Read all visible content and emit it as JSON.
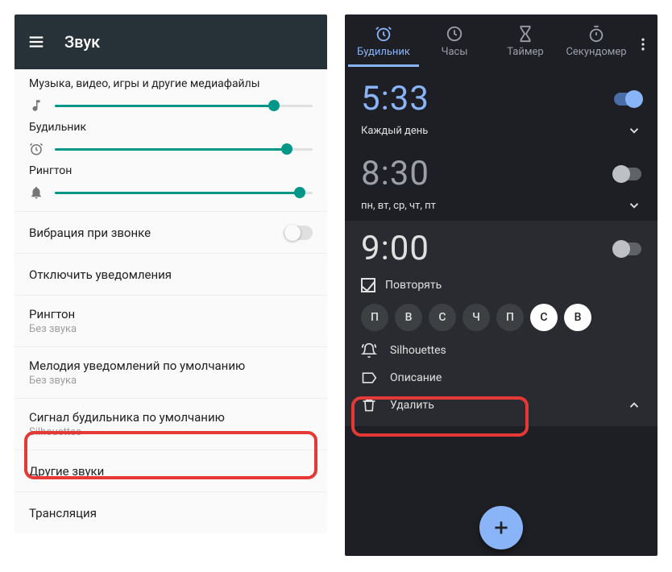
{
  "left": {
    "title": "Звук",
    "sliders": {
      "media": {
        "label": "Музыка, видео, игры и другие медиафайлы",
        "value": 85
      },
      "alarm": {
        "label": "Будильник",
        "value": 90
      },
      "ringtone": {
        "label": "Рингтон",
        "value": 95
      }
    },
    "vibrate": {
      "label": "Вибрация при звонке",
      "on": false
    },
    "mute": {
      "label": "Отключить уведомления"
    },
    "ringtone_row": {
      "label": "Рингтон",
      "sub": "Без звука"
    },
    "notif_row": {
      "label": "Мелодия уведомлений по умолчанию",
      "sub": "Без звука"
    },
    "alarm_row": {
      "label": "Сигнал будильника по умолчанию",
      "sub": "Silhouettes"
    },
    "other": {
      "label": "Другие звуки"
    },
    "cast": {
      "label": "Трансляция"
    }
  },
  "right": {
    "tabs": {
      "alarm": "Будильник",
      "clock": "Часы",
      "timer": "Таймер",
      "stopwatch": "Секундомер"
    },
    "alarms": [
      {
        "time": "5:33",
        "days": "Каждый день",
        "on": true
      },
      {
        "time": "8:30",
        "days": "пн, вт, ср, чт, пт",
        "on": false
      },
      {
        "time": "9:00",
        "on": false
      }
    ],
    "expanded": {
      "repeat": "Повторять",
      "day_labels": [
        "П",
        "В",
        "С",
        "Ч",
        "П",
        "С",
        "В"
      ],
      "day_active": [
        false,
        false,
        false,
        false,
        false,
        true,
        true
      ],
      "ringtone": "Silhouettes",
      "label": "Описание",
      "delete": "Удалить"
    }
  }
}
